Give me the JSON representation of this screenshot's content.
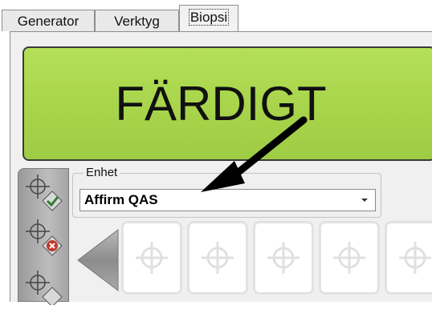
{
  "tabs": [
    {
      "label": "Generator",
      "active": false
    },
    {
      "label": "Verktyg",
      "active": false
    },
    {
      "label": "Biopsi",
      "active": true
    }
  ],
  "status": {
    "text": "FÄRDIGT",
    "color": "#a7d34a"
  },
  "device": {
    "group_label": "Enhet",
    "selected": "Affirm QAS"
  },
  "sidebar": {
    "icons": [
      "target-check-icon",
      "target-x-icon",
      "target-icon"
    ]
  },
  "slots": {
    "count": 5,
    "icon": "crosshair-icon"
  }
}
